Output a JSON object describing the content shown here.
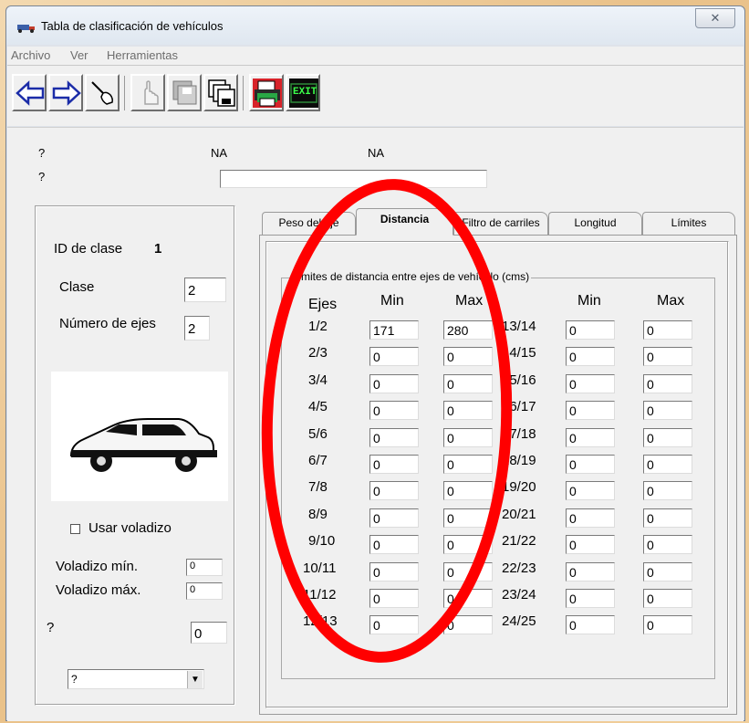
{
  "window": {
    "title": "Tabla de clasificación de vehículos",
    "close_glyph": "✕"
  },
  "menu": [
    "Archivo",
    "Ver",
    "Herramientas"
  ],
  "toolbar": {
    "buttons": [
      "back-arrow-icon",
      "forward-arrow-icon",
      "tool-icon",
      "hand-icon",
      "disk-stack-icon",
      "multi-disk-icon",
      "printer-icon",
      "exit-icon"
    ],
    "exit_label": "EXIT"
  },
  "header": {
    "row1_q": "?",
    "row1_na1": "NA",
    "row1_na2": "NA",
    "row2_q": "?",
    "row2_value": ""
  },
  "left": {
    "class_id_label": "ID de clase",
    "class_id_value": "1",
    "class_label": "Clase",
    "class_value": "2",
    "axles_label": "Número de ejes",
    "axles_value": "2",
    "overhang_checkbox_label": "Usar voladizo",
    "overhang_min_label": "Voladizo mín.",
    "overhang_min_value": "0",
    "overhang_max_label": "Voladizo máx.",
    "overhang_max_value": "0",
    "q_label": "?",
    "q_value": "0",
    "dropdown_value": "?"
  },
  "tabs": [
    {
      "label": "Peso del eje",
      "active": false
    },
    {
      "label": "Distancia",
      "active": true
    },
    {
      "label": "Filtro de carriles",
      "active": false
    },
    {
      "label": "Longitud",
      "active": false
    },
    {
      "label": "Límites",
      "active": false
    }
  ],
  "distance": {
    "group_title": "Límites de distancia entre ejes de vehículo (cms)",
    "headers": {
      "ejes": "Ejes",
      "min": "Min",
      "max": "Max",
      "min2": "Min",
      "max2": "Max"
    },
    "left_rows": [
      {
        "label": "1/2",
        "min": "171",
        "max": "280"
      },
      {
        "label": "2/3",
        "min": "0",
        "max": "0"
      },
      {
        "label": "3/4",
        "min": "0",
        "max": "0"
      },
      {
        "label": "4/5",
        "min": "0",
        "max": "0"
      },
      {
        "label": "5/6",
        "min": "0",
        "max": "0"
      },
      {
        "label": "6/7",
        "min": "0",
        "max": "0"
      },
      {
        "label": "7/8",
        "min": "0",
        "max": "0"
      },
      {
        "label": "8/9",
        "min": "0",
        "max": "0"
      },
      {
        "label": "9/10",
        "min": "0",
        "max": "0"
      },
      {
        "label": "10/11",
        "min": "0",
        "max": "0"
      },
      {
        "label": "11/12",
        "min": "0",
        "max": "0"
      },
      {
        "label": "12/13",
        "min": "0",
        "max": "0"
      }
    ],
    "right_rows": [
      {
        "label": "13/14",
        "min": "0",
        "max": "0"
      },
      {
        "label": "14/15",
        "min": "0",
        "max": "0"
      },
      {
        "label": "15/16",
        "min": "0",
        "max": "0"
      },
      {
        "label": "16/17",
        "min": "0",
        "max": "0"
      },
      {
        "label": "17/18",
        "min": "0",
        "max": "0"
      },
      {
        "label": "18/19",
        "min": "0",
        "max": "0"
      },
      {
        "label": "19/20",
        "min": "0",
        "max": "0"
      },
      {
        "label": "20/21",
        "min": "0",
        "max": "0"
      },
      {
        "label": "21/22",
        "min": "0",
        "max": "0"
      },
      {
        "label": "22/23",
        "min": "0",
        "max": "0"
      },
      {
        "label": "23/24",
        "min": "0",
        "max": "0"
      },
      {
        "label": "24/25",
        "min": "0",
        "max": "0"
      }
    ]
  },
  "colors": {
    "annotation": "#ff0000",
    "window_bg": "#f0f0f0"
  }
}
